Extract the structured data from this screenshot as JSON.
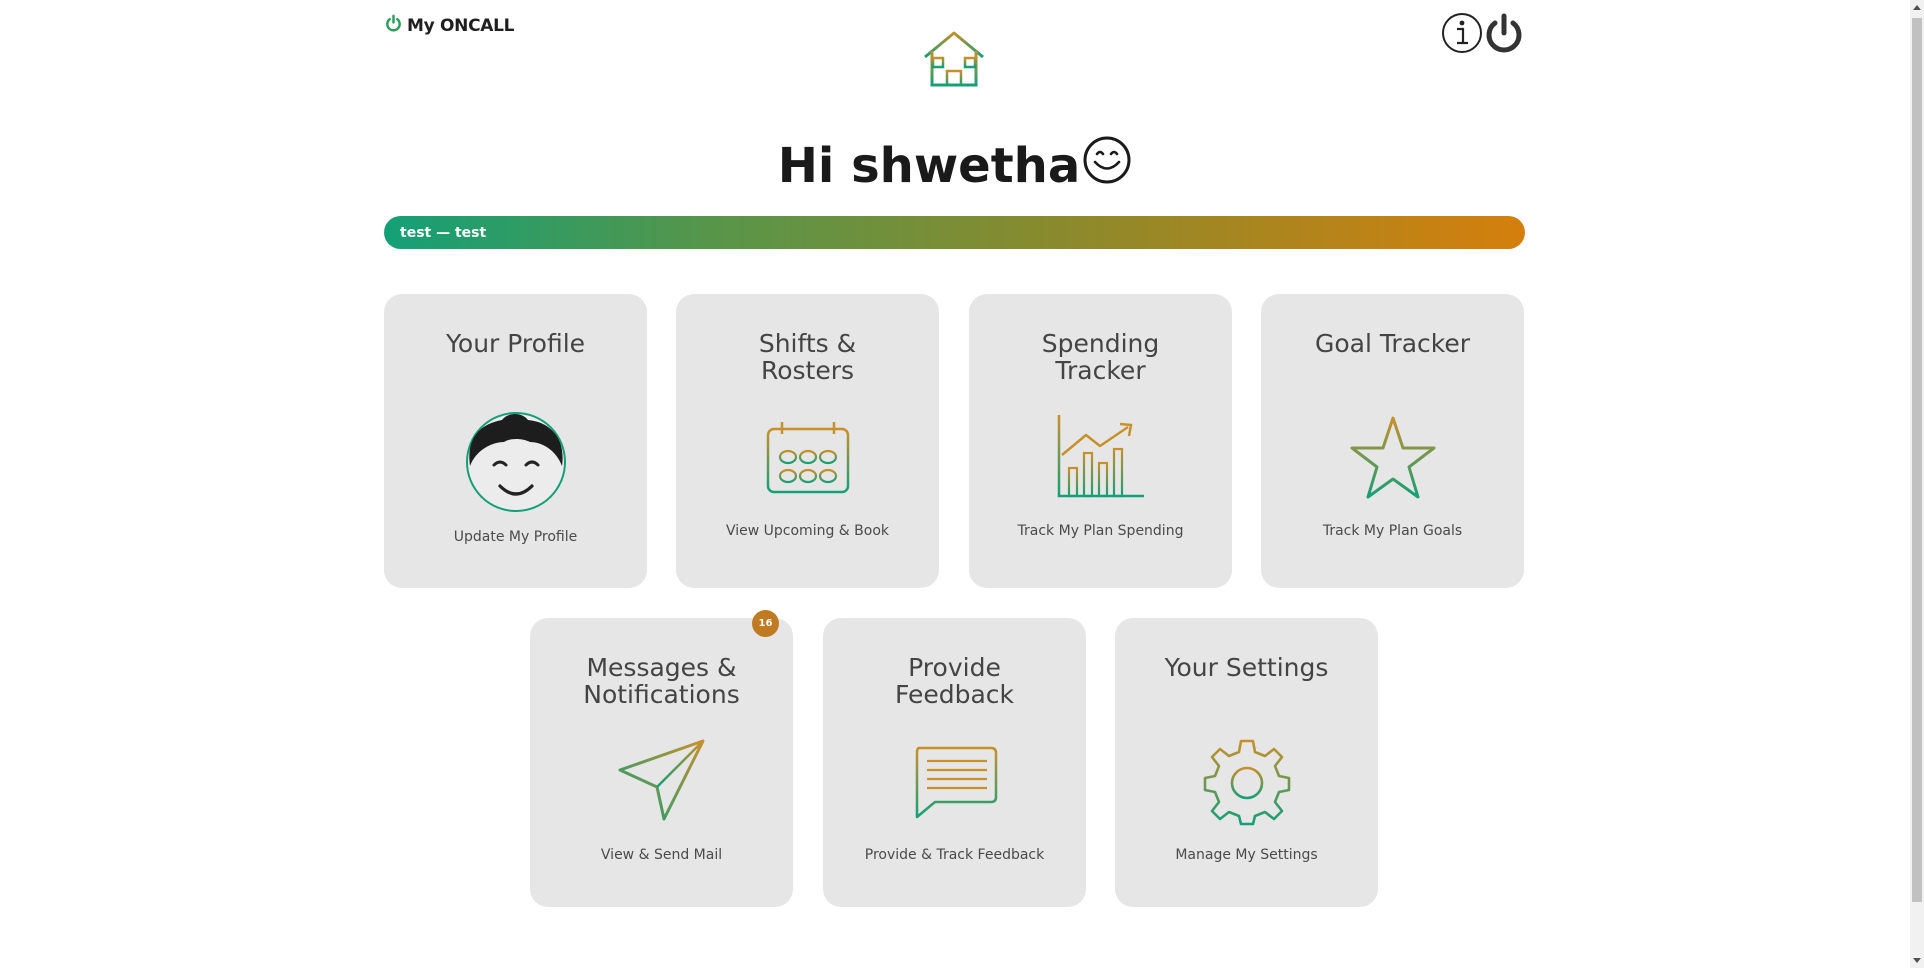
{
  "header": {
    "brand_label": "My ONCALL",
    "brand_icon": "power-icon",
    "home_icon": "home-icon",
    "info_icon": "info-icon",
    "logout_icon": "power-icon"
  },
  "greeting": {
    "text": "Hi shwetha",
    "emoji_icon": "smiley-icon"
  },
  "banner": {
    "text": "test — test"
  },
  "tiles": [
    {
      "title": "Your Profile",
      "subtitle": "Update My Profile",
      "icon": "avatar-icon"
    },
    {
      "title": "Shifts & Rosters",
      "subtitle": "View Upcoming & Book",
      "icon": "calendar-icon"
    },
    {
      "title": "Spending Tracker",
      "subtitle": "Track My Plan Spending",
      "icon": "bar-chart-icon"
    },
    {
      "title": "Goal Tracker",
      "subtitle": "Track My Plan Goals",
      "icon": "star-icon"
    },
    {
      "title": "Messages & Notifications",
      "subtitle": "View & Send Mail",
      "icon": "paper-plane-icon",
      "badge": "16"
    },
    {
      "title": "Provide Feedback",
      "subtitle": "Provide & Track Feedback",
      "icon": "chat-icon"
    },
    {
      "title": "Your Settings",
      "subtitle": "Manage My Settings",
      "icon": "gear-icon"
    }
  ],
  "colors": {
    "green": "#13a077",
    "gold": "#c8902a",
    "orange": "#d57f0c",
    "tile_bg": "#e6e6e6"
  }
}
